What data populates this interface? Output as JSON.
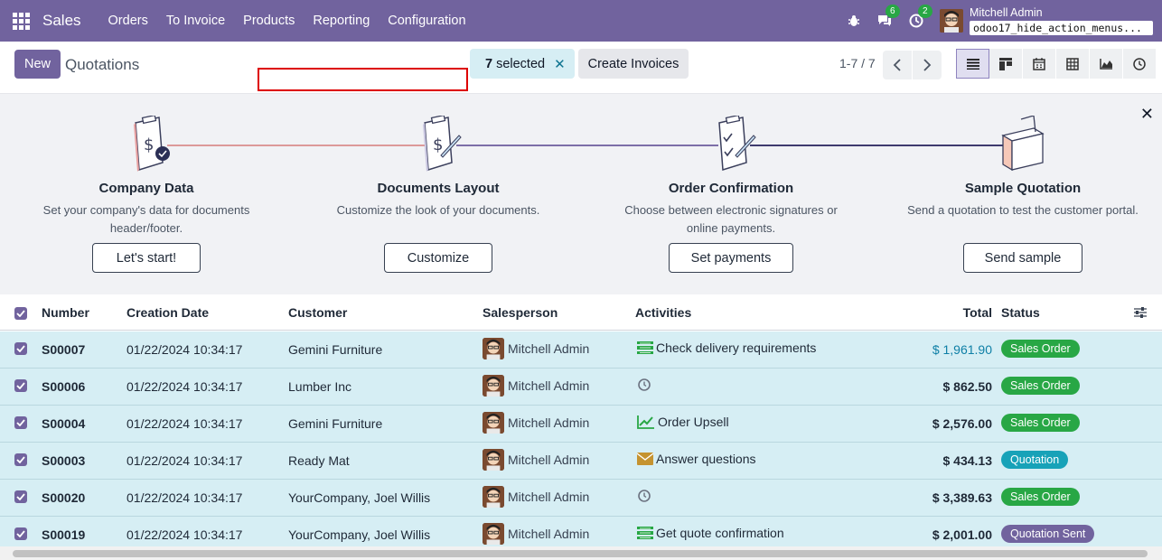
{
  "navbar": {
    "brand": "Sales",
    "menu": [
      "Orders",
      "To Invoice",
      "Products",
      "Reporting",
      "Configuration"
    ],
    "messages_count": "6",
    "activities_count": "2",
    "user_name": "Mitchell Admin",
    "db_name": "odoo17_hide_action_menus..."
  },
  "control": {
    "new_label": "New",
    "title": "Quotations",
    "selected_count": "7",
    "selected_label": "selected",
    "create_invoices_label": "Create Invoices",
    "pager": "1-7 / 7"
  },
  "onboarding": {
    "steps": [
      {
        "title": "Company Data",
        "desc": "Set your company's data for documents header/footer.",
        "button": "Let's start!"
      },
      {
        "title": "Documents Layout",
        "desc": "Customize the look of your documents.",
        "button": "Customize"
      },
      {
        "title": "Order Confirmation",
        "desc": "Choose between electronic signatures or online payments.",
        "button": "Set payments"
      },
      {
        "title": "Sample Quotation",
        "desc": "Send a quotation to test the customer portal.",
        "button": "Send sample"
      }
    ]
  },
  "table": {
    "headers": {
      "number": "Number",
      "date": "Creation Date",
      "customer": "Customer",
      "salesperson": "Salesperson",
      "activities": "Activities",
      "total": "Total",
      "status": "Status"
    },
    "rows": [
      {
        "number": "S00007",
        "date": "01/22/2024 10:34:17",
        "customer": "Gemini Furniture",
        "salesperson": "Mitchell Admin",
        "activity": "Check delivery requirements",
        "activity_icon": "list-icon",
        "total": "$ 1,961.90",
        "status": "Sales Order",
        "status_color": "#28a745"
      },
      {
        "number": "S00006",
        "date": "01/22/2024 10:34:17",
        "customer": "Lumber Inc",
        "salesperson": "Mitchell Admin",
        "activity": "",
        "activity_icon": "clock-icon",
        "total": "$ 862.50",
        "status": "Sales Order",
        "status_color": "#28a745"
      },
      {
        "number": "S00004",
        "date": "01/22/2024 10:34:17",
        "customer": "Gemini Furniture",
        "salesperson": "Mitchell Admin",
        "activity": "Order Upsell",
        "activity_icon": "chart-icon",
        "total": "$ 2,576.00",
        "status": "Sales Order",
        "status_color": "#28a745"
      },
      {
        "number": "S00003",
        "date": "01/22/2024 10:34:17",
        "customer": "Ready Mat",
        "salesperson": "Mitchell Admin",
        "activity": "Answer questions",
        "activity_icon": "envelope-icon",
        "total": "$ 434.13",
        "status": "Quotation",
        "status_color": "#17a2b8"
      },
      {
        "number": "S00020",
        "date": "01/22/2024 10:34:17",
        "customer": "YourCompany, Joel Willis",
        "salesperson": "Mitchell Admin",
        "activity": "",
        "activity_icon": "clock-icon",
        "total": "$ 3,389.63",
        "status": "Sales Order",
        "status_color": "#28a745"
      },
      {
        "number": "S00019",
        "date": "01/22/2024 10:34:17",
        "customer": "YourCompany, Joel Willis",
        "salesperson": "Mitchell Admin",
        "activity": "Get quote confirmation",
        "activity_icon": "list-icon",
        "total": "$ 2,001.00",
        "status": "Quotation Sent",
        "status_color": "#71639e"
      }
    ]
  }
}
